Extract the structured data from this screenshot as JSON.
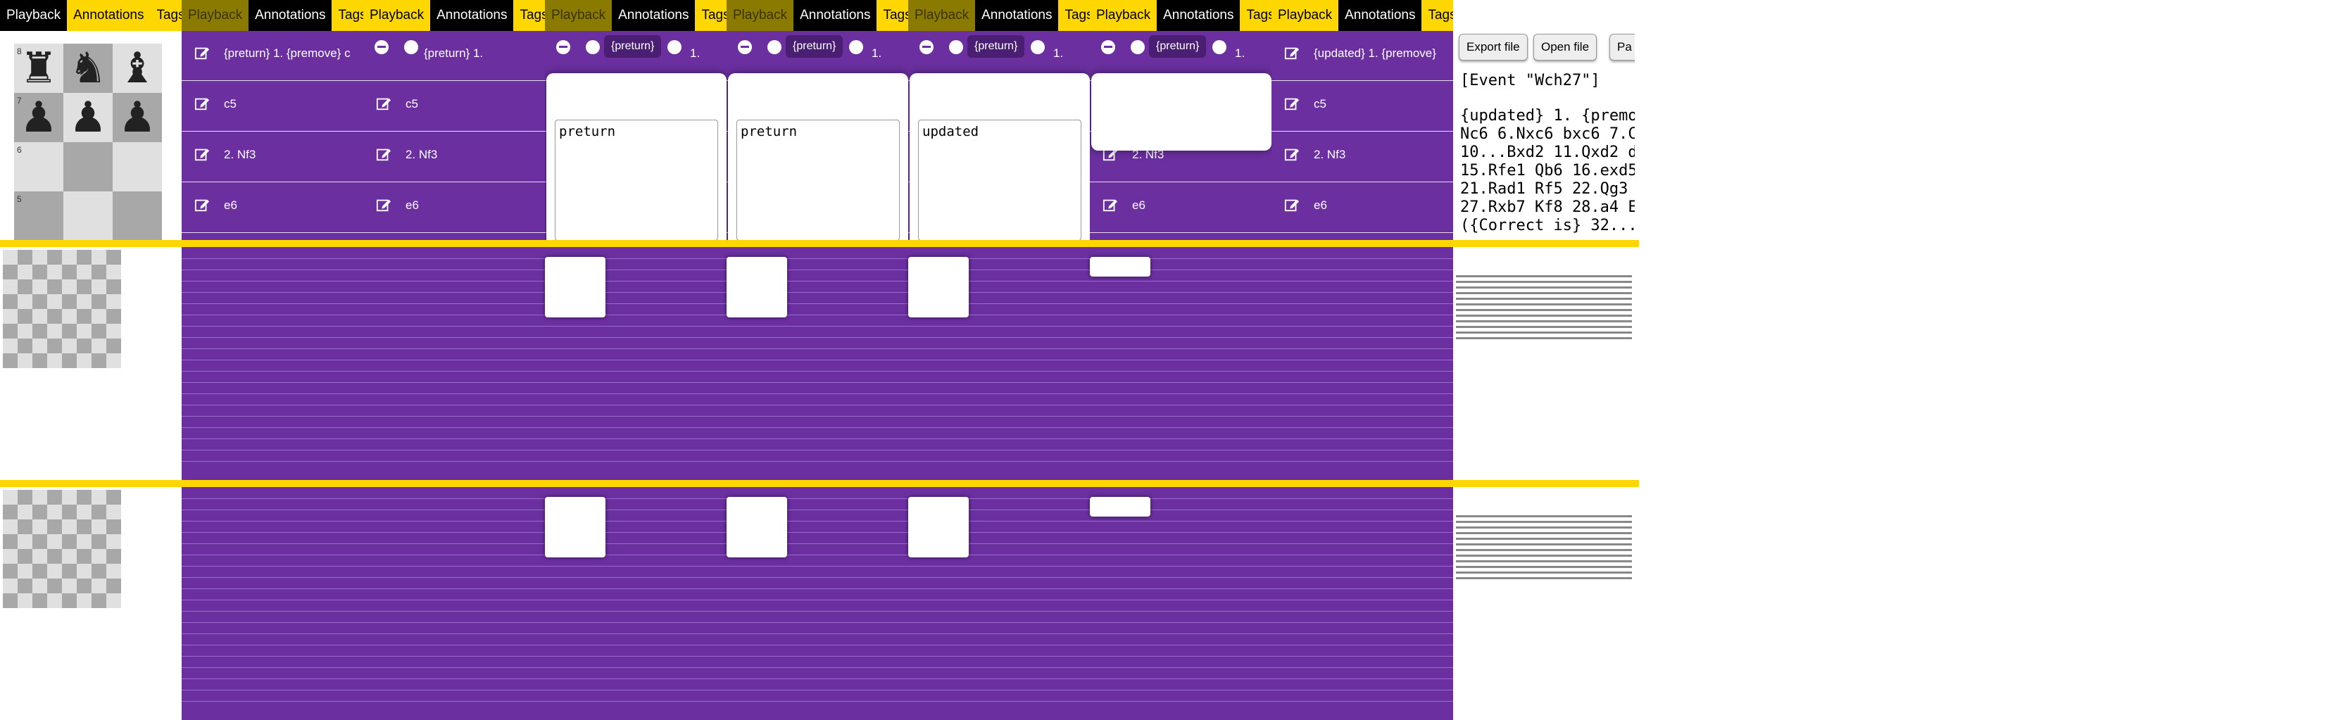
{
  "tabs": {
    "playback": "Playback",
    "annotations": "Annotations",
    "tags": "Tags"
  },
  "moves": [
    {
      "text": "{preturn}  1.  {premove}"
    },
    {
      "text": "c5"
    },
    {
      "text": "2.  Nf3"
    },
    {
      "text": "e6"
    }
  ],
  "panels": [
    {
      "move1": "{preturn}  1.  {premove}  c"
    },
    {
      "move1": "{preturn}  1."
    },
    {
      "pill": "{preturn}",
      "tail": "1.",
      "editor": "preturn"
    },
    {
      "pill": "{preturn}",
      "tail": "1.",
      "editor": "preturn"
    },
    {
      "pill": "{preturn}",
      "tail": "1.",
      "editor": "updated"
    },
    {
      "pill": "{preturn}",
      "tail": "1."
    },
    {
      "move1": "{updated}  1.  {premove}"
    }
  ],
  "ranks": [
    "8",
    "7",
    "6",
    "5"
  ],
  "pgn": {
    "export": "Export file",
    "open": "Open file",
    "third": "Pa",
    "event": "[Event \"Wch27\"]",
    "lines": [
      "{updated} 1. {premo",
      "Nc6 6.Nxc6 bxc6 7.C",
      "10...Bxd2 11.Qxd2 d",
      "15.Rfe1 Qb6 16.exd5",
      "21.Rad1 Rf5 22.Qg3",
      "27.Rxb7 Kf8 28.a4 E",
      "({Correct is} 32..."
    ]
  },
  "colors": {
    "purple": "#6b2fa0",
    "gold": "#ffd700",
    "dark": "#000000"
  }
}
